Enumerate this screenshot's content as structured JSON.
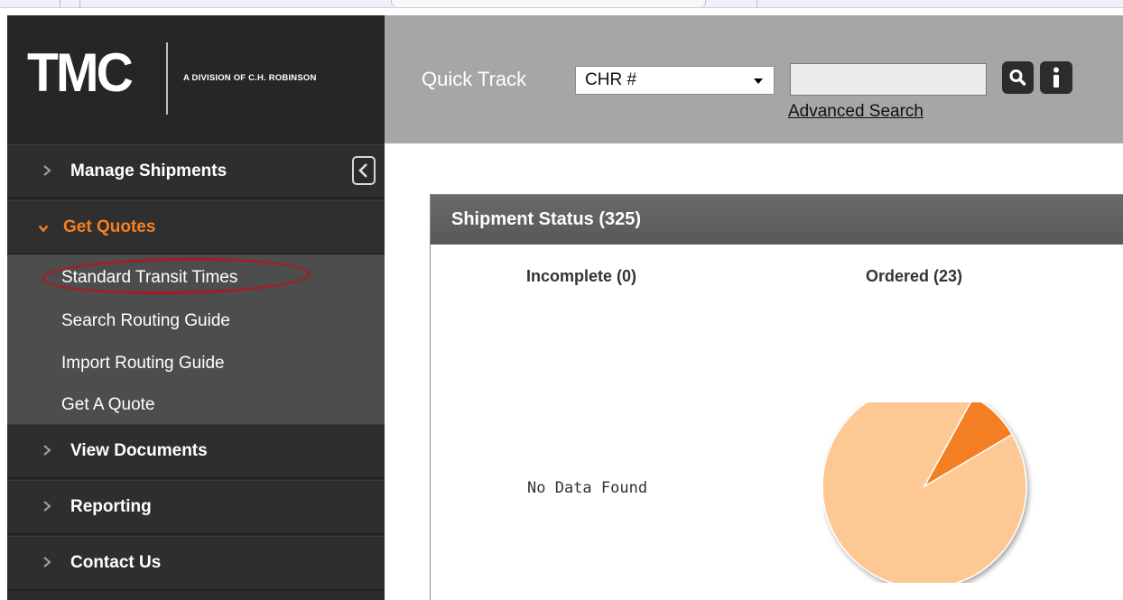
{
  "logo": {
    "text": "TMC",
    "subtitle": "A DIVISION OF C.H. ROBINSON"
  },
  "sidebar": {
    "items": [
      {
        "label": "Manage Shipments",
        "expanded": false
      },
      {
        "label": "Get Quotes",
        "expanded": true,
        "children": [
          {
            "label": "Standard Transit Times",
            "highlighted": true
          },
          {
            "label": "Search Routing Guide"
          },
          {
            "label": "Import Routing Guide"
          },
          {
            "label": "Get A Quote"
          }
        ]
      },
      {
        "label": "View Documents",
        "expanded": false
      },
      {
        "label": "Reporting",
        "expanded": false
      },
      {
        "label": "Contact Us",
        "expanded": false
      }
    ]
  },
  "header": {
    "quick_track_label": "Quick Track",
    "select_value": "CHR #",
    "search_value": "",
    "advanced_search_label": "Advanced Search"
  },
  "panel": {
    "title": "Shipment Status (325)",
    "columns": [
      {
        "title": "Incomplete (0)",
        "empty_text": "No Data Found"
      },
      {
        "title": "Ordered (23)"
      }
    ]
  },
  "chart_data": {
    "type": "pie",
    "title": "Ordered (23)",
    "slices": [
      {
        "value": 0.915,
        "color": "#fdc894"
      },
      {
        "value": 0.085,
        "color": "#f47f24"
      }
    ]
  },
  "colors": {
    "accent": "#f4801f",
    "highlight_oval": "#a51c24",
    "sidebar_bg": "#2b2b2b",
    "header_bg": "#a6a6a6"
  }
}
